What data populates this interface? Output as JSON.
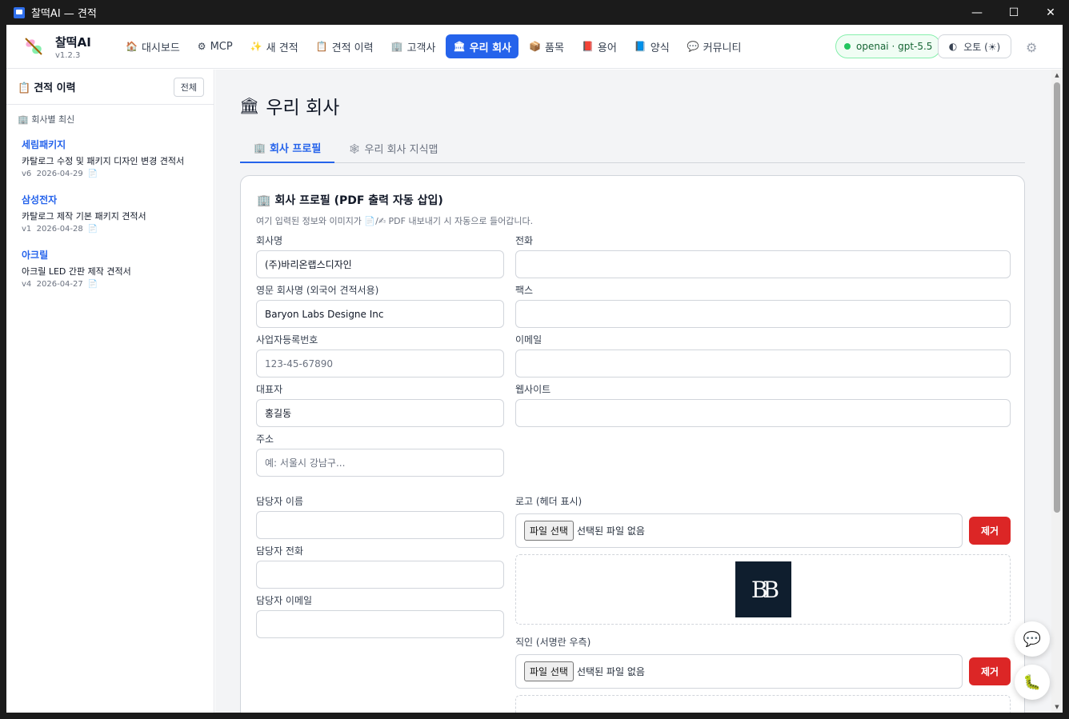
{
  "window": {
    "title": "찰떡AI — 견적",
    "minimize": "—",
    "maximize": "☐",
    "close": "✕"
  },
  "brand": {
    "name": "찰떡AI",
    "version": "v1.2.3"
  },
  "nav": [
    {
      "icon": "🏠",
      "icon_name": "house-icon",
      "label": "대시보드"
    },
    {
      "icon": "⚙",
      "icon_name": "plug-icon",
      "label": "MCP"
    },
    {
      "icon": "✨",
      "icon_name": "sparkle-icon",
      "label": "새 견적"
    },
    {
      "icon": "📋",
      "icon_name": "clipboard-icon",
      "label": "견적 이력"
    },
    {
      "icon": "🏢",
      "icon_name": "building-icon",
      "label": "고객사"
    },
    {
      "icon": "🏛",
      "icon_name": "company-icon",
      "label": "우리 회사",
      "active": true
    },
    {
      "icon": "📦",
      "icon_name": "box-icon",
      "label": "품목"
    },
    {
      "icon": "📕",
      "icon_name": "book-icon",
      "label": "용어"
    },
    {
      "icon": "📘",
      "icon_name": "form-icon",
      "label": "양식"
    },
    {
      "icon": "💬",
      "icon_name": "chat-icon",
      "label": "커뮤니티"
    }
  ],
  "model": {
    "label": "openai · gpt-5.5",
    "status_color": "#22c55e"
  },
  "theme": {
    "label": "오토 (☀)"
  },
  "sidebar": {
    "title": "견적 이력",
    "all_button": "전체",
    "section": "회사별 최신",
    "items": [
      {
        "company": "세림패키지",
        "doc": "카탈로그 수정 및 패키지 디자인 변경 견적서",
        "version": "v6",
        "date": "2026-04-29"
      },
      {
        "company": "삼성전자",
        "doc": "카탈로그 제작 기본 패키지 견적서",
        "version": "v1",
        "date": "2026-04-28"
      },
      {
        "company": "아크릴",
        "doc": "아크릴 LED 간판 제작 견적서",
        "version": "v4",
        "date": "2026-04-27"
      }
    ]
  },
  "page": {
    "title": "우리 회사",
    "tabs": [
      {
        "label": "회사 프로필",
        "active": true
      },
      {
        "label": "우리 회사 지식맵"
      }
    ]
  },
  "profile": {
    "title": "회사 프로필 (PDF 출력 자동 삽입)",
    "desc": "여기 입력된 정보와 이미지가 📄/✍ PDF 내보내기 시 자동으로 들어갑니다.",
    "fields": {
      "company_name": {
        "label": "회사명",
        "value": "(주)바리온랩스디자인"
      },
      "phone": {
        "label": "전화",
        "value": ""
      },
      "english_name": {
        "label": "영문 회사명 (외국어 견적서용)",
        "value": "Baryon Labs Designe Inc"
      },
      "fax": {
        "label": "팩스",
        "value": ""
      },
      "biz_number": {
        "label": "사업자등록번호",
        "placeholder": "123-45-67890"
      },
      "email": {
        "label": "이메일",
        "value": ""
      },
      "ceo": {
        "label": "대표자",
        "value": "홍길동"
      },
      "website": {
        "label": "웹사이트",
        "value": ""
      },
      "address": {
        "label": "주소",
        "placeholder": "예: 서울시 강남구..."
      },
      "contact_name": {
        "label": "담당자 이름",
        "value": ""
      },
      "contact_phone": {
        "label": "담당자 전화",
        "value": ""
      },
      "contact_email": {
        "label": "담당자 이메일",
        "value": ""
      }
    },
    "logo": {
      "label": "로고 (헤더 표시)",
      "file_button": "파일 선택",
      "file_status": "선택된 파일 없음",
      "remove": "제거",
      "image_text": "BB"
    },
    "seal": {
      "label": "직인 (서명란 우측)",
      "file_button": "파일 선택",
      "file_status": "선택된 파일 없음",
      "remove": "제거"
    }
  },
  "colors": {
    "accent": "#2563eb",
    "danger": "#dc2626"
  }
}
